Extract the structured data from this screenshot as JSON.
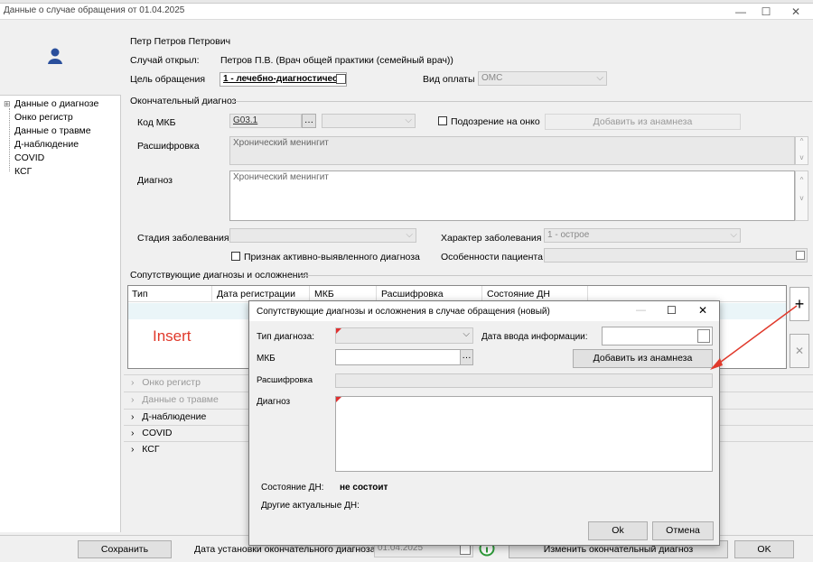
{
  "window": {
    "top_strip": "",
    "title": "Данные о случае обращения от 01.04.2025",
    "controls": {
      "minimize": "—",
      "maximize": "☐",
      "close": "✕"
    }
  },
  "header": {
    "patient_name": "Петр Петров Петрович",
    "opened_by_label": "Случай открыл:",
    "opened_by_value": "Петров П.В. (Врач общей практики (семейный врач))",
    "purpose_label": "Цель обращения",
    "purpose_value": "1 - лечебно-диагностичес",
    "payment_label": "Вид оплаты",
    "payment_value": "ОМС"
  },
  "tree": {
    "items": [
      "Данные о диагнозе",
      "Онко регистр",
      "Данные о травме",
      "Д-наблюдение",
      "COVID",
      "КСГ"
    ]
  },
  "final_diagnosis": {
    "group_title": "Окончательный диагноз",
    "mkb_label": "Код МКБ",
    "mkb_value": "G03.1",
    "onco_suspicion_label": "Подозрение на онко",
    "add_from_anamnesis": "Добавить из анамнеза",
    "decoding_label": "Расшифровка",
    "decoding_value": "Хронический менингит",
    "diagnosis_label": "Диагноз",
    "diagnosis_value": "Хронический менингит",
    "stage_label": "Стадия заболевания",
    "character_label": "Характер заболевания",
    "character_value": "1 - острое",
    "active_detected_label": "Признак активно-выявленного диагноза",
    "patient_features_label": "Особенности пациента"
  },
  "concomitant": {
    "group_title": "Сопутствующие диагнозы и осложнения",
    "columns": [
      "Тип",
      "Дата регистрации",
      "МКБ",
      "Расшифровка",
      "Состояние ДН"
    ],
    "insert_label": "Insert",
    "add_symbol": "+",
    "remove_symbol": "✕"
  },
  "sections": [
    "Онко регистр",
    "Данные о травме",
    "Д-наблюдение",
    "COVID",
    "КСГ"
  ],
  "bottom": {
    "save": "Сохранить",
    "date_label": "Дата установки окончательного диагноза:",
    "date_value": "01.04.2025",
    "change_diagnosis": "Изменить окончательный диагноз",
    "ok": "OK"
  },
  "dialog": {
    "title": "Сопутствующие диагнозы и осложнения в случае обращения (новый)",
    "type_label": "Тип диагноза:",
    "date_input_label": "Дата ввода информации:",
    "mkb_label": "МКБ",
    "add_from_anamnesis": "Добавить из анамнеза",
    "decoding_label": "Расшифровка",
    "diagnosis_label": "Диагноз",
    "dn_state_label": "Состояние ДН:",
    "dn_state_value": "не состоит",
    "other_dn_label": "Другие актуальные ДН:",
    "ok": "Ok",
    "cancel": "Отмена"
  },
  "colors": {
    "arrow": "#e0392b",
    "insert_text": "#e0392b",
    "grid_border": "#888888"
  }
}
